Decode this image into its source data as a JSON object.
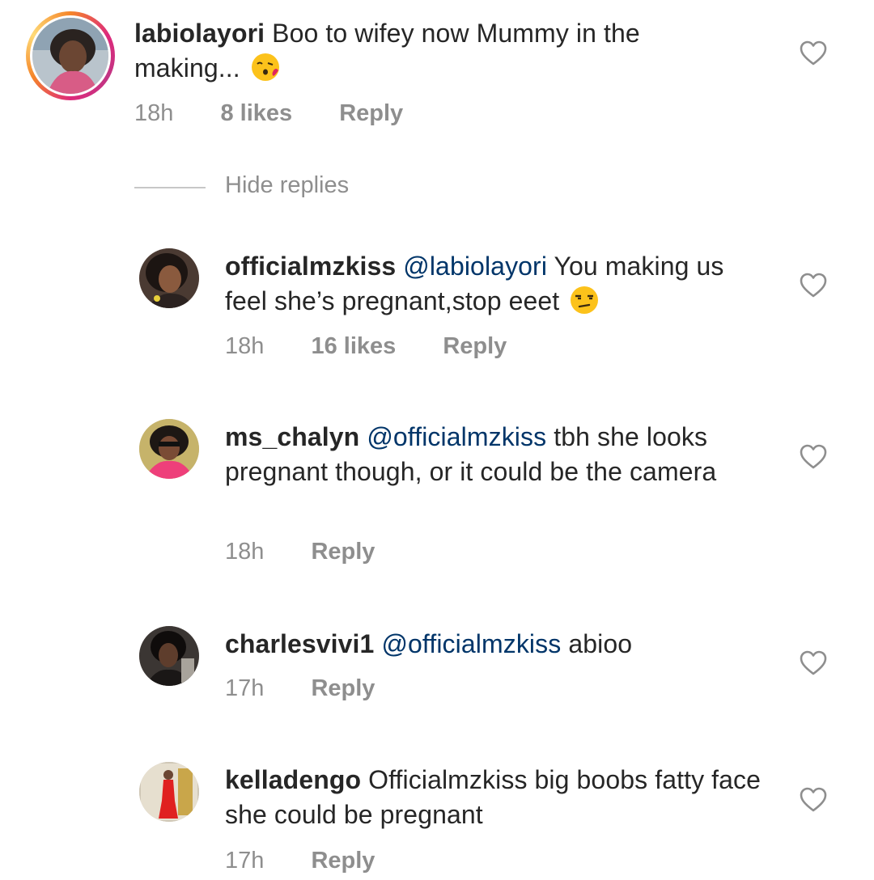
{
  "comments": [
    {
      "username": "labiolayori",
      "mention": "",
      "text": "Boo to  wifey  now Mummy in the making...",
      "emoji": "kissing-face-emoji",
      "time": "18h",
      "likes": "8 likes",
      "reply_label": "Reply"
    },
    {
      "username": "officialmzkiss",
      "mention": "@labiolayori",
      "text": "You making us feel she’s pregnant,stop eeet",
      "emoji": "unamused-face-emoji",
      "time": "18h",
      "likes": "16 likes",
      "reply_label": "Reply"
    },
    {
      "username": "ms_chalyn",
      "mention": "@officialmzkiss",
      "text": "tbh she looks pregnant though, or it could be the camera",
      "time": "18h",
      "likes": "",
      "reply_label": "Reply"
    },
    {
      "username": "charlesvivi1",
      "mention": "@officialmzkiss",
      "text": "abioo",
      "time": "17h",
      "likes": "",
      "reply_label": "Reply"
    },
    {
      "username": "kelladengo",
      "mention": "",
      "text": "Officialmzkiss big boobs fatty face she could be pregnant",
      "time": "17h",
      "likes": "",
      "reply_label": "Reply"
    }
  ],
  "hide_replies_label": "Hide replies",
  "colors": {
    "text": "#262626",
    "meta": "#8e8e8e",
    "mention": "#003569",
    "story_ring_start": "#f58529",
    "story_ring_end": "#dd2a7b"
  }
}
